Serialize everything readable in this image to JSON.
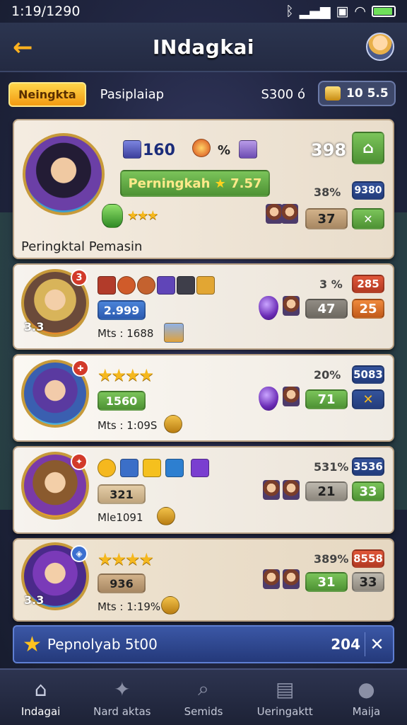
{
  "status": {
    "time": "1:19/1290"
  },
  "header": {
    "title": "INdagkai"
  },
  "filter": {
    "tag": "Neingkta",
    "label": "Pasiplaiap",
    "value": "S300 ó",
    "coin_value": "10 5.5"
  },
  "cards": [
    {
      "name": "Peringktal Pemasin",
      "level_a": "160",
      "level_b": "%",
      "score": "398",
      "rank_label": "Perningkah",
      "rank_value": "7.57",
      "pct": "38%",
      "stat_a": "9380",
      "stat_b": "37",
      "colors": {
        "portrait": "#5a3f8f"
      }
    },
    {
      "level": "2.999",
      "mts": "Mts : 1688",
      "pct": "3 %",
      "stat_a": "285",
      "stat_b": "47",
      "stat_c": "25",
      "badge_a": "3",
      "badge_b": "3.3"
    },
    {
      "level": "1560",
      "mts": "Mts : 1:09S",
      "pct": "20%",
      "stat_a": "5083",
      "stat_b": "71"
    },
    {
      "level": "321",
      "mts": "Mle1091",
      "pct": "531%",
      "stat_a": "3536",
      "stat_b": "21",
      "stat_c": "33"
    },
    {
      "level": "936",
      "mts": "Mts : 1:19%",
      "pct": "389%",
      "stat_a": "8558",
      "stat_b": "31",
      "stat_c": "33",
      "badge_a": "3.3"
    }
  ],
  "banner": {
    "label": "Pepnolyab 5t00",
    "value": "204"
  },
  "nav": [
    {
      "label": "Indagai"
    },
    {
      "label": "Nard aktas"
    },
    {
      "label": "Semids"
    },
    {
      "label": "Ueringaktt"
    },
    {
      "label": "Maija"
    }
  ]
}
